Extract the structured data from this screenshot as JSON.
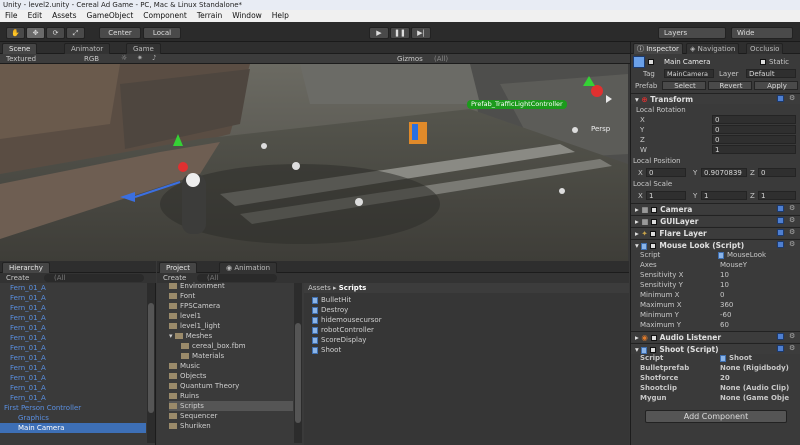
{
  "window": {
    "title": "Unity - level2.unity - Cereal Ad Game - PC, Mac & Linux Standalone*"
  },
  "menu": [
    "File",
    "Edit",
    "Assets",
    "GameObject",
    "Component",
    "Terrain",
    "Window",
    "Help"
  ],
  "toolbar": {
    "pivot_label": "Center",
    "space_label": "Local",
    "layers_label": "Layers",
    "layout_label": "Wide"
  },
  "scene_tabs": {
    "scene": "Scene",
    "animator": "Animator",
    "game": "Game"
  },
  "scene_bar": {
    "mode": "Textured",
    "color": "RGB",
    "gizmos": "Gizmos",
    "gizmos_filter": "(All)"
  },
  "scene_labels": {
    "prefab_tag": "Prefab_TrafficLightController",
    "persp": "Persp"
  },
  "hierarchy": {
    "tab": "Hierarchy",
    "create": "Create",
    "search": "(All",
    "items": [
      "Fern_01_A",
      "Fern_01_A",
      "Fern_01_A",
      "Fern_01_A",
      "Fern_01_A",
      "Fern_01_A",
      "Fern_01_A",
      "Fern_01_A",
      "Fern_01_A",
      "Fern_01_A",
      "Fern_01_A",
      "Fern_01_A"
    ],
    "fpc": "First Person Controller",
    "graphics": "Graphics",
    "main_camera": "Main Camera"
  },
  "project": {
    "tab": "Project",
    "animation_tab": "Animation",
    "create": "Create",
    "search": "(All",
    "folders": [
      "Environment",
      "Font",
      "FPSCamera",
      "level1",
      "level1_light",
      "Meshes",
      "cereal_box.fbm",
      "Materials",
      "Music",
      "Objects",
      "Quantum Theory",
      "Ruins",
      "Scripts",
      "Sequencer",
      "Shuriken"
    ],
    "breadcrumb_root": "Assets",
    "breadcrumb_sep": "▸",
    "breadcrumb_leaf": "Scripts",
    "scripts": [
      "BulletHit",
      "Destroy",
      "hidemousecursor",
      "robotController",
      "ScoreDisplay",
      "Shoot"
    ]
  },
  "inspector": {
    "tabs": {
      "inspector": "Inspector",
      "navigation": "Navigation",
      "occlusion": "Occlusio"
    },
    "object_name": "Main Camera",
    "static_label": "Static",
    "tag_label": "Tag",
    "tag_value": "MainCamera",
    "layer_label": "Layer",
    "layer_value": "Default",
    "prefab_label": "Prefab",
    "select_label": "Select",
    "revert_label": "Revert",
    "apply_label": "Apply",
    "transform": {
      "title": "Transform",
      "local_rotation": "Local Rotation",
      "rx": "X",
      "rx_v": "0",
      "ry": "Y",
      "ry_v": "0",
      "rz": "Z",
      "rz_v": "0",
      "rw": "W",
      "rw_v": "1",
      "local_position": "Local Position",
      "px": "X",
      "px_v": "0",
      "py": "Y",
      "py_v": "0.9070839",
      "pz": "Z",
      "pz_v": "0",
      "local_scale": "Local Scale",
      "sx": "X",
      "sx_v": "1",
      "sy": "Y",
      "sy_v": "1",
      "sz": "Z",
      "sz_v": "1"
    },
    "camera": "Camera",
    "guilayer": "GUILayer",
    "flarelayer": "Flare Layer",
    "mouselook": {
      "title": "Mouse Look (Script)",
      "rows": [
        {
          "label": "Script",
          "value": "MouseLook"
        },
        {
          "label": "Axes",
          "value": "MouseY"
        },
        {
          "label": "Sensitivity X",
          "value": "10"
        },
        {
          "label": "Sensitivity Y",
          "value": "10"
        },
        {
          "label": "Minimum X",
          "value": "0"
        },
        {
          "label": "Maximum X",
          "value": "360"
        },
        {
          "label": "Minimum Y",
          "value": "-60"
        },
        {
          "label": "Maximum Y",
          "value": "60"
        }
      ]
    },
    "audio_listener": "Audio Listener",
    "shoot": {
      "title": "Shoot (Script)",
      "rows": [
        {
          "label": "Script",
          "value": "Shoot"
        },
        {
          "label": "Bulletprefab",
          "value": "None (Rigidbody)"
        },
        {
          "label": "Shotforce",
          "value": "20"
        },
        {
          "label": "Shootclip",
          "value": "None (Audio Clip)"
        },
        {
          "label": "Mygun",
          "value": "None (Game Obje"
        }
      ]
    },
    "add_component": "Add Component"
  }
}
